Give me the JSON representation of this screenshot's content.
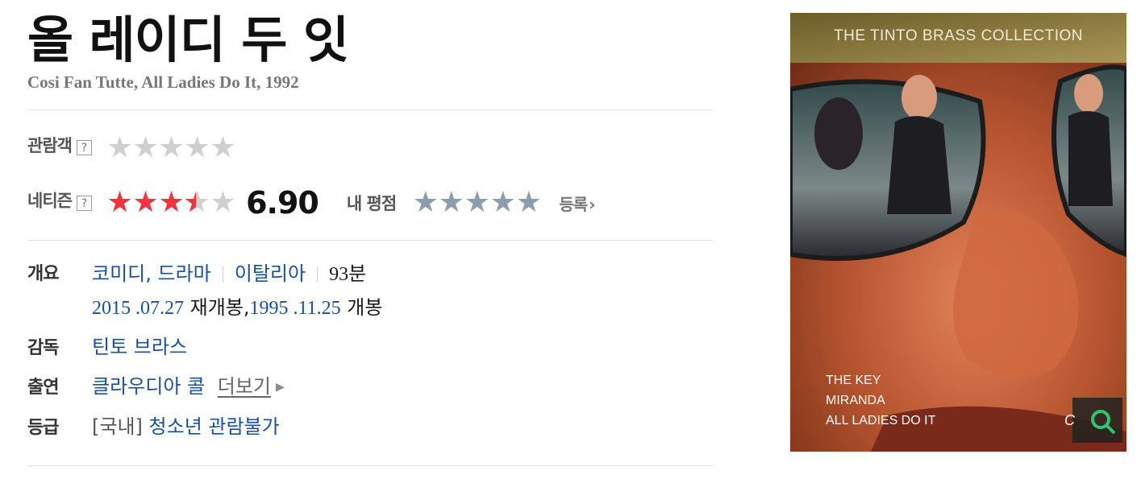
{
  "movie": {
    "title": "올 레이디 두 잇",
    "original": "Cosi Fan Tutte, All Ladies Do It, 1992"
  },
  "ratings": {
    "audience_label": "관람객",
    "audience_help": "?",
    "audience_stars": 0,
    "netizen_label": "네티즌",
    "netizen_help": "?",
    "netizen_stars": 3.45,
    "netizen_score": "6.90",
    "my_label": "내 평점",
    "my_stars": 0,
    "register_label": "등록"
  },
  "details": {
    "overview_label": "개요",
    "genres": "코미디, 드라마",
    "country": "이탈리아",
    "runtime_num": "93",
    "runtime_unit": "분",
    "release1_date": "2015 .07.27",
    "release1_text": "재개봉,",
    "release2_date": "1995 .11.25",
    "release2_text": "개봉",
    "director_label": "감독",
    "director": "틴토 브라스",
    "cast_label": "출연",
    "cast": "클라우디아 콜",
    "more_label": "더보기",
    "grade_label": "등급",
    "grade_region": "[국내]",
    "grade": "청소년 관람불가"
  },
  "poster": {
    "header": "THE TINTO BRASS COLLECTION",
    "line1": "THE KEY",
    "line2": "MIRANDA",
    "line3": "ALL LADIES DO IT",
    "badge": "C"
  },
  "colors": {
    "star_filled": "#f1323f",
    "star_empty": "#cfcfcf",
    "my_star": "#8c9eae",
    "link": "#1a4fa0"
  }
}
